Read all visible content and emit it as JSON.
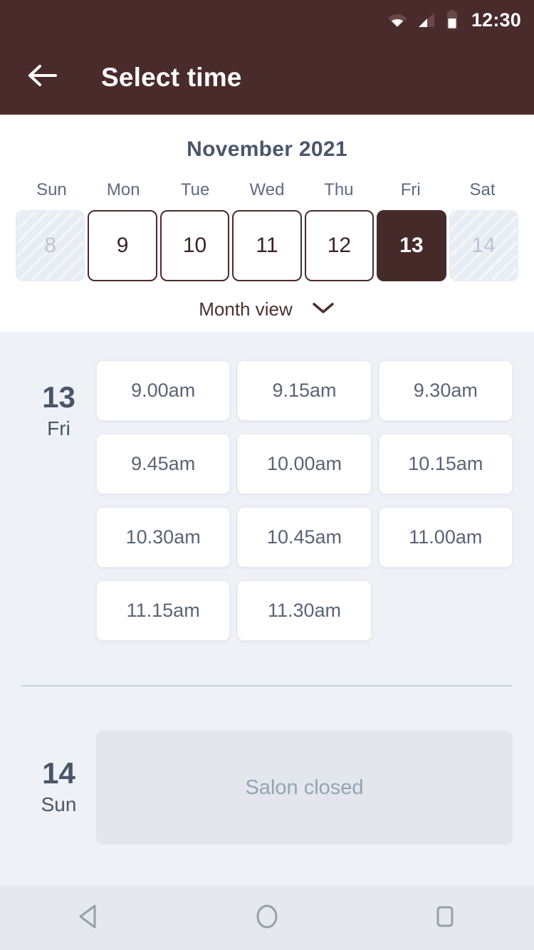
{
  "statusbar": {
    "time": "12:30",
    "icons": [
      "wifi-icon",
      "signal-icon",
      "battery-icon"
    ]
  },
  "appbar": {
    "title": "Select time",
    "back_icon": "back-arrow-icon"
  },
  "calendar": {
    "month_title": "November 2021",
    "weekdays": [
      "Sun",
      "Mon",
      "Tue",
      "Wed",
      "Thu",
      "Fri",
      "Sat"
    ],
    "days": [
      {
        "num": "8",
        "state": "disabled"
      },
      {
        "num": "9",
        "state": "available"
      },
      {
        "num": "10",
        "state": "available"
      },
      {
        "num": "11",
        "state": "available"
      },
      {
        "num": "12",
        "state": "available"
      },
      {
        "num": "13",
        "state": "selected"
      },
      {
        "num": "14",
        "state": "disabled"
      }
    ],
    "view_toggle_label": "Month view",
    "view_toggle_icon": "chevron-down-icon"
  },
  "schedule": [
    {
      "day_num": "13",
      "day_of_week": "Fri",
      "closed": false,
      "slots": [
        "9.00am",
        "9.15am",
        "9.30am",
        "9.45am",
        "10.00am",
        "10.15am",
        "10.30am",
        "10.45am",
        "11.00am",
        "11.15am",
        "11.30am"
      ]
    },
    {
      "day_num": "14",
      "day_of_week": "Sun",
      "closed": true,
      "closed_label": "Salon closed",
      "slots": []
    }
  ],
  "navbar": {
    "back_icon": "nav-back-triangle-icon",
    "home_icon": "nav-home-circle-icon",
    "recents_icon": "nav-recents-square-icon"
  },
  "colors": {
    "brand_maroon": "#4a2b2b",
    "selected_day": "#452a2a",
    "page_bg": "#eef1f6",
    "card_bg": "#ffffff",
    "closed_panel_bg": "#e3e7ed",
    "slate_text": "#4b5568",
    "muted_text": "#98a2b4"
  }
}
